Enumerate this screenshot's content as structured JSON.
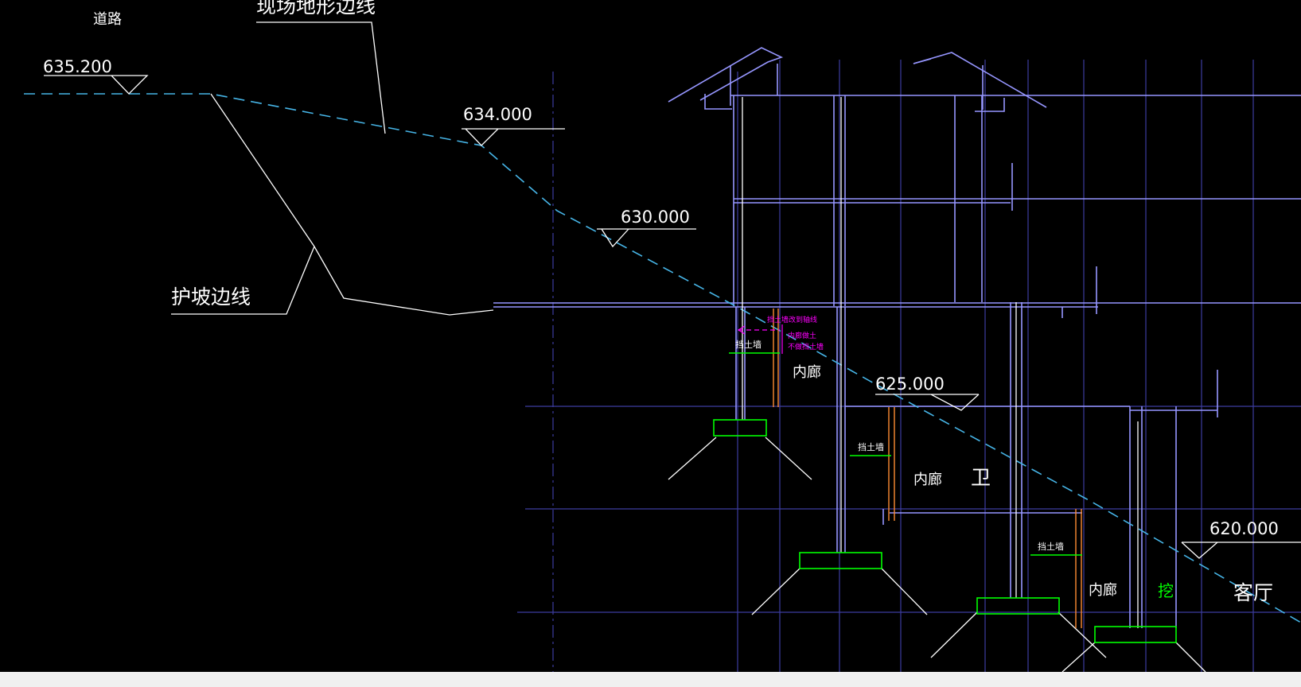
{
  "drawing": {
    "labels": {
      "road": "道路",
      "terrain_line": "现场地形边线",
      "slope_protection_line": "护坡边线",
      "elev_635": "635.200",
      "elev_634": "634.000",
      "elev_630": "630.000",
      "elev_625": "625.000",
      "elev_620": "620.000",
      "corridor_1": "内廊",
      "corridor_2": "内廊",
      "corridor_3": "内廊",
      "retaining_wall_1": "挡土墙",
      "retaining_wall_2": "挡土墙",
      "retaining_wall_3": "挡土墙",
      "bathroom": "卫",
      "living_room": "客厅",
      "excavate": "挖",
      "note_line_1": "挡土墙改到轴线",
      "note_line_2": "内廊做土",
      "note_line_3": "不做挡土墙"
    },
    "colors": {
      "grid": "#3c3ca0",
      "building": "#9696ff",
      "terrain": "#46b4e6",
      "white": "#ffffff",
      "footing": "#00ff00",
      "orange": "#ff8c32",
      "magenta": "#ff00ff"
    }
  }
}
